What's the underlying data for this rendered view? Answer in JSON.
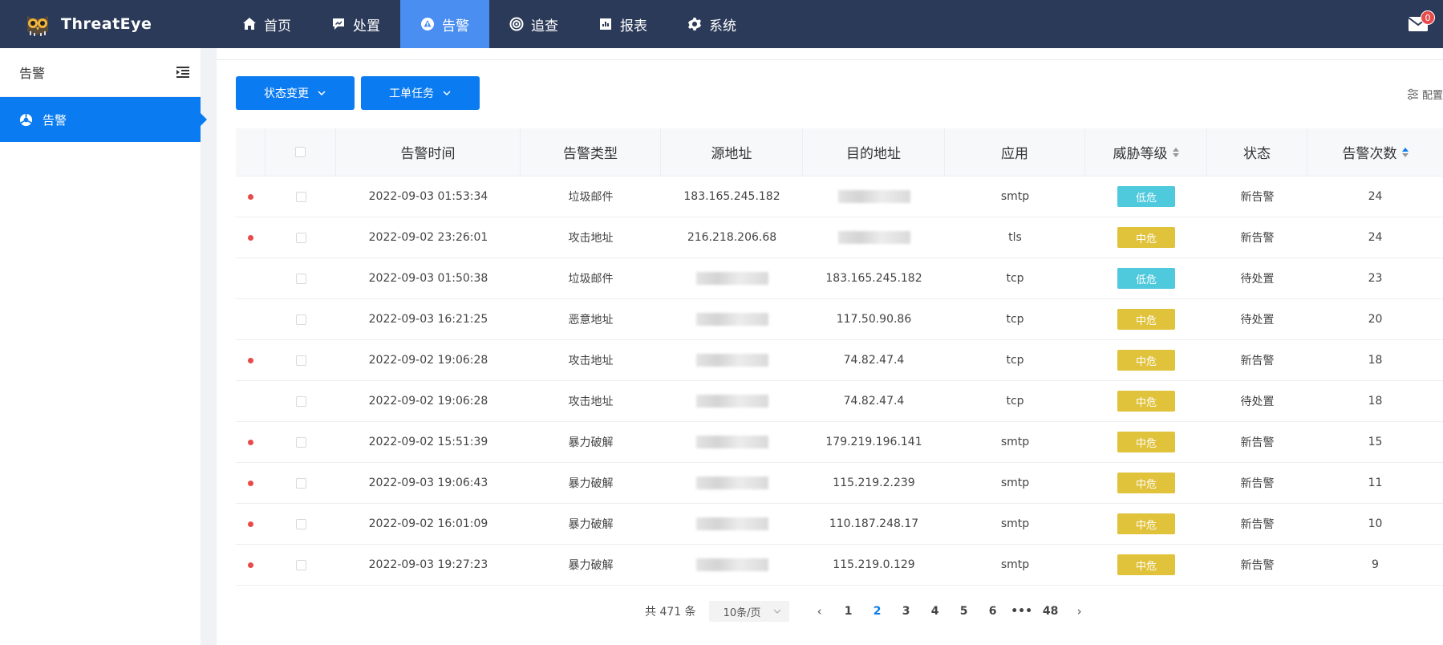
{
  "app": {
    "brand": "ThreatEye"
  },
  "nav": [
    {
      "label": "首页",
      "icon": "home-icon",
      "active": false
    },
    {
      "label": "处置",
      "icon": "dispose-icon",
      "active": false
    },
    {
      "label": "告警",
      "icon": "alert-icon",
      "active": true
    },
    {
      "label": "追查",
      "icon": "trace-icon",
      "active": false
    },
    {
      "label": "报表",
      "icon": "report-icon",
      "active": false
    },
    {
      "label": "系统",
      "icon": "gear-icon",
      "active": false
    }
  ],
  "mail": {
    "badge": "0"
  },
  "sidebar": {
    "title": "告警",
    "items": [
      {
        "label": "告警",
        "icon": "alert-circle-icon"
      }
    ]
  },
  "toolbar": {
    "status_change": "状态变更",
    "work_order": "工单任务",
    "config": "配置"
  },
  "table": {
    "headers": [
      "告警时间",
      "告警类型",
      "源地址",
      "目的地址",
      "应用",
      "威胁等级",
      "状态",
      "告警次数"
    ],
    "rows": [
      {
        "dot": true,
        "time": "2022-09-03 01:53:34",
        "type": "垃圾邮件",
        "src": "183.165.245.182",
        "dst": "",
        "app": "smtp",
        "level": "低危",
        "status": "新告警",
        "count": "24"
      },
      {
        "dot": true,
        "time": "2022-09-02 23:26:01",
        "type": "攻击地址",
        "src": "216.218.206.68",
        "dst": "",
        "app": "tls",
        "level": "中危",
        "status": "新告警",
        "count": "24"
      },
      {
        "dot": false,
        "time": "2022-09-03 01:50:38",
        "type": "垃圾邮件",
        "src": "",
        "dst": "183.165.245.182",
        "app": "tcp",
        "level": "低危",
        "status": "待处置",
        "count": "23"
      },
      {
        "dot": false,
        "time": "2022-09-03 16:21:25",
        "type": "恶意地址",
        "src": "",
        "dst": "117.50.90.86",
        "app": "tcp",
        "level": "中危",
        "status": "待处置",
        "count": "20"
      },
      {
        "dot": true,
        "time": "2022-09-02 19:06:28",
        "type": "攻击地址",
        "src": "",
        "dst": "74.82.47.4",
        "app": "tcp",
        "level": "中危",
        "status": "新告警",
        "count": "18"
      },
      {
        "dot": false,
        "time": "2022-09-02 19:06:28",
        "type": "攻击地址",
        "src": "",
        "dst": "74.82.47.4",
        "app": "tcp",
        "level": "中危",
        "status": "待处置",
        "count": "18"
      },
      {
        "dot": true,
        "time": "2022-09-02 15:51:39",
        "type": "暴力破解",
        "src": "",
        "dst": "179.219.196.141",
        "app": "smtp",
        "level": "中危",
        "status": "新告警",
        "count": "15"
      },
      {
        "dot": true,
        "time": "2022-09-03 19:06:43",
        "type": "暴力破解",
        "src": "",
        "dst": "115.219.2.239",
        "app": "smtp",
        "level": "中危",
        "status": "新告警",
        "count": "11"
      },
      {
        "dot": true,
        "time": "2022-09-02 16:01:09",
        "type": "暴力破解",
        "src": "",
        "dst": "110.187.248.17",
        "app": "smtp",
        "level": "中危",
        "status": "新告警",
        "count": "10"
      },
      {
        "dot": true,
        "time": "2022-09-03 19:27:23",
        "type": "暴力破解",
        "src": "",
        "dst": "115.219.0.129",
        "app": "smtp",
        "level": "中危",
        "status": "新告警",
        "count": "9"
      }
    ]
  },
  "level_colors": {
    "低危": "#4fc9dc",
    "中危": "#e0c23b"
  },
  "pagination": {
    "total": "共 471 条",
    "page_size": "10条/页",
    "pages": [
      "1",
      "2",
      "3",
      "4",
      "5",
      "6",
      "•••",
      "48"
    ],
    "current": "2"
  }
}
